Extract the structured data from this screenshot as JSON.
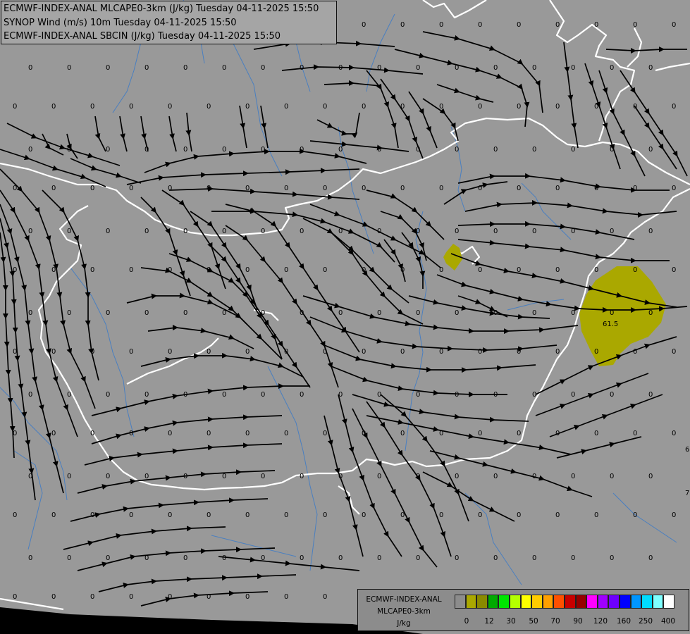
{
  "header": {
    "line1": "ECMWF-INDEX-ANAL MLCAPE0-3km (J/kg) Tuesday 04-11-2025 15:50",
    "line2": "SYNOP Wind (m/s) 10m Tuesday 04-11-2025 15:50",
    "line3": "ECMWF-INDEX-ANAL SBCIN (J/kg) Tuesday 04-11-2025 15:50"
  },
  "map": {
    "background": "#999999",
    "border_color": "#ffffff",
    "river_color": "#4a7fc0",
    "streamline_color": "#000000",
    "cape_fill_color": "#aaa800",
    "cape_value_label": "61.5",
    "edge_labels": [
      "6",
      "7"
    ],
    "zero_label": "0"
  },
  "legend": {
    "title1": "ECMWF-INDEX-ANAL",
    "title2": "MLCAPE0-3km",
    "unit": "J/kg",
    "colors": [
      "#8c8c8c",
      "#aaa800",
      "#8a8a00",
      "#00aa00",
      "#00e600",
      "#b4ff00",
      "#ffff00",
      "#ffcc00",
      "#ffa000",
      "#ff5000",
      "#c80000",
      "#960000",
      "#ff00ff",
      "#a000ff",
      "#6e00ff",
      "#0000ff",
      "#0096ff",
      "#00dcff",
      "#7effff",
      "#ffffff"
    ],
    "ticks": [
      "0",
      "12",
      "30",
      "50",
      "70",
      "90",
      "120",
      "160",
      "250",
      "400"
    ]
  }
}
